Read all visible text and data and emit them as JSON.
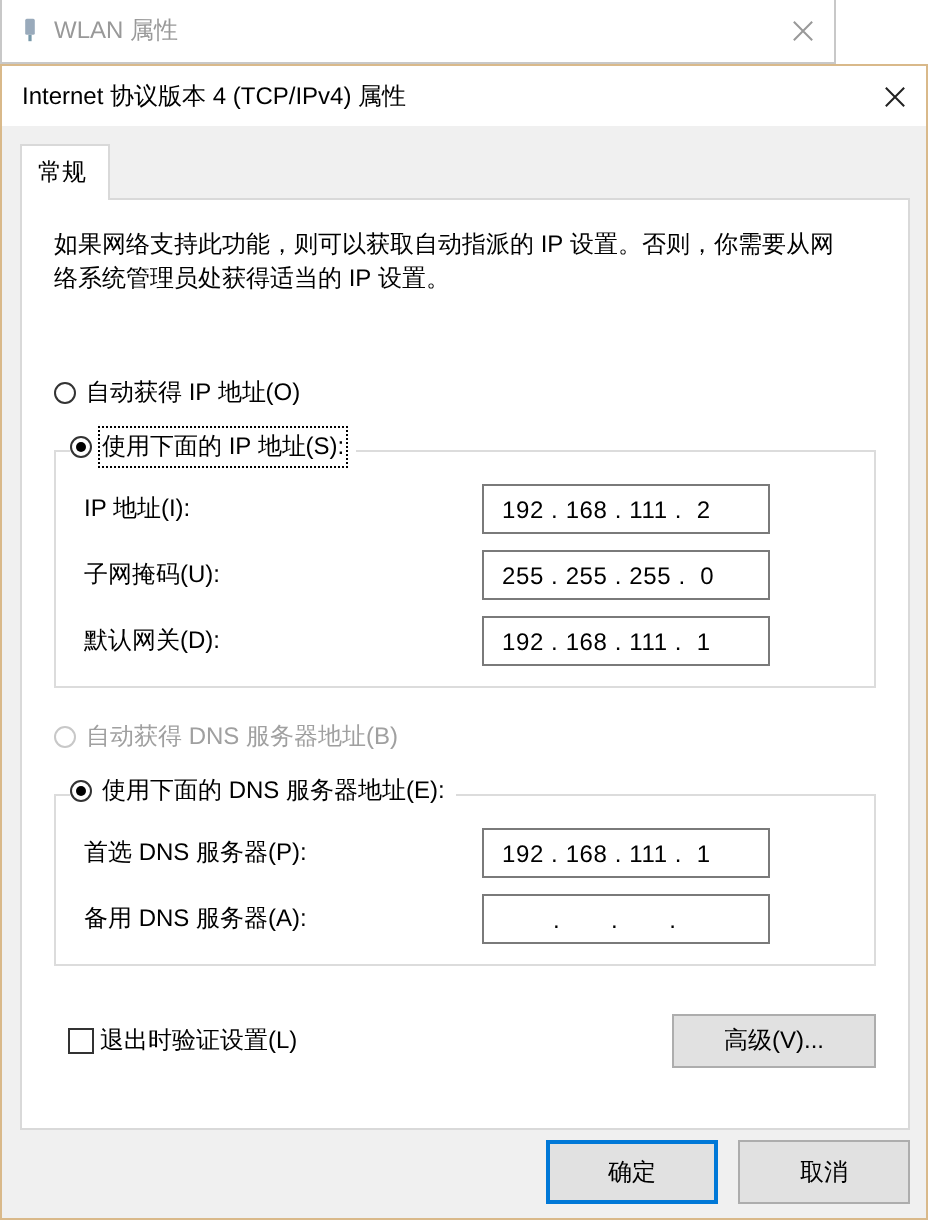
{
  "background_window": {
    "title": "WLAN 属性"
  },
  "dialog": {
    "title": "Internet 协议版本 4 (TCP/IPv4) 属性",
    "tabs": [
      {
        "label": "常规",
        "selected": true
      }
    ],
    "description": "如果网络支持此功能，则可以获取自动指派的 IP 设置。否则，你需要从网络系统管理员处获得适当的 IP 设置。",
    "ip_section": {
      "auto_option": {
        "label": "自动获得 IP 地址(O)",
        "selected": false
      },
      "manual_option": {
        "label": "使用下面的 IP 地址(S):",
        "selected": true,
        "focused": true
      },
      "fields": [
        {
          "label": "IP 地址(I):",
          "value": "192 . 168 . 111 .  2"
        },
        {
          "label": "子网掩码(U):",
          "value": "255 . 255 . 255 .  0"
        },
        {
          "label": "默认网关(D):",
          "value": "192 . 168 . 111 .  1"
        }
      ]
    },
    "dns_section": {
      "auto_option": {
        "label": "自动获得 DNS 服务器地址(B)",
        "selected": false,
        "disabled": true
      },
      "manual_option": {
        "label": "使用下面的 DNS 服务器地址(E):",
        "selected": true
      },
      "fields": [
        {
          "label": "首选 DNS 服务器(P):",
          "value": "192 . 168 . 111 .  1"
        },
        {
          "label": "备用 DNS 服务器(A):",
          "value": "       .       .       ."
        }
      ]
    },
    "validate_checkbox": {
      "label": "退出时验证设置(L)",
      "checked": false
    },
    "advanced_button": "高级(V)...",
    "buttons": [
      {
        "label": "确定",
        "default": true
      },
      {
        "label": "取消",
        "default": false
      }
    ]
  }
}
